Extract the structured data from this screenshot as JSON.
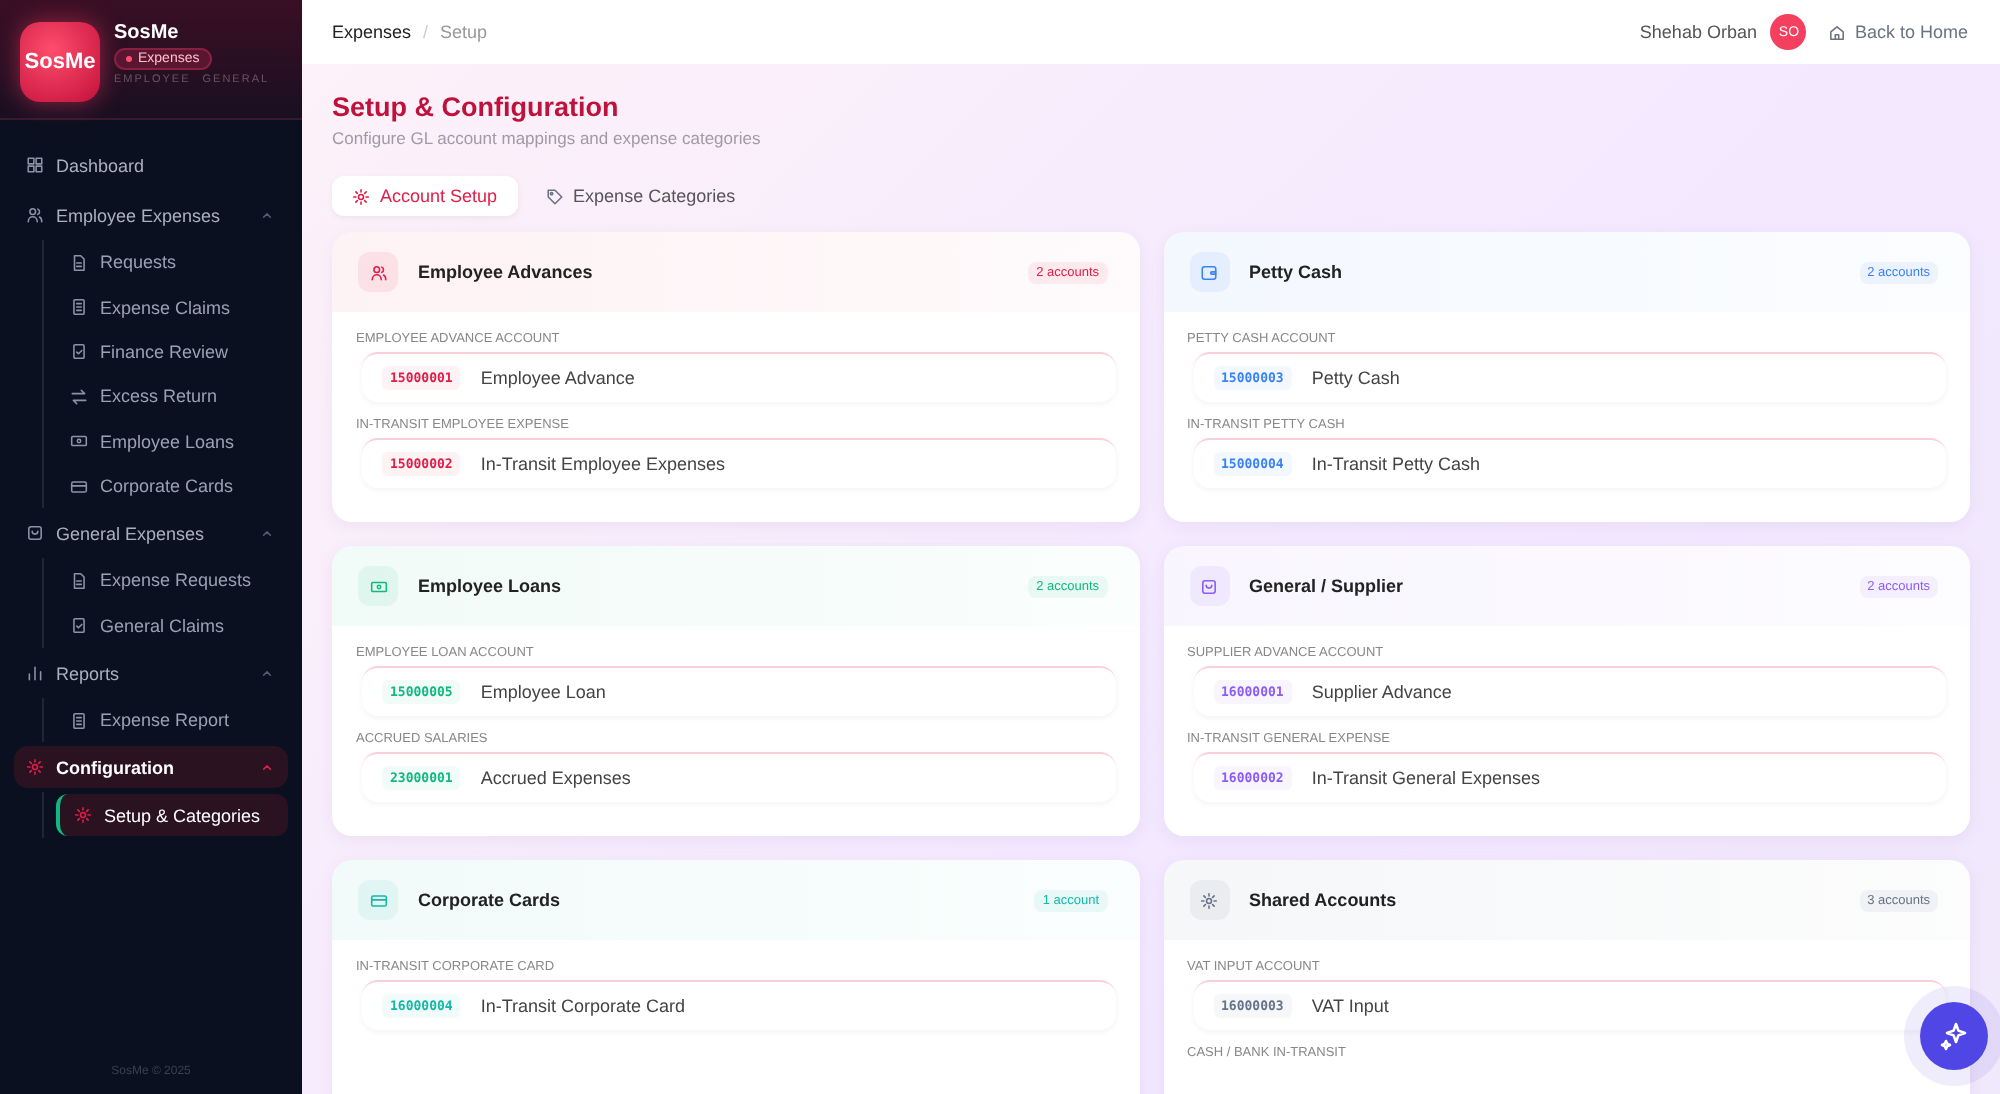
{
  "sidebar": {
    "logo": "SosMe",
    "brand": "SosMe",
    "badge": "Expenses",
    "tags": [
      "EMPLOYEE",
      "GENERAL"
    ],
    "items": [
      {
        "kind": "link",
        "label": "Dashboard",
        "selected": false
      },
      {
        "kind": "group",
        "label": "Employee Expenses",
        "expanded": true,
        "selected": false,
        "children": [
          {
            "label": "Requests",
            "selected": false
          },
          {
            "label": "Expense Claims",
            "selected": false
          },
          {
            "label": "Finance Review",
            "selected": false
          },
          {
            "label": "Excess Return",
            "selected": false
          },
          {
            "label": "Employee Loans",
            "selected": false
          },
          {
            "label": "Corporate Cards",
            "selected": false
          }
        ]
      },
      {
        "kind": "group",
        "label": "General Expenses",
        "expanded": true,
        "selected": false,
        "children": [
          {
            "label": "Expense Requests",
            "selected": false
          },
          {
            "label": "General Claims",
            "selected": false
          }
        ]
      },
      {
        "kind": "group",
        "label": "Reports",
        "expanded": true,
        "selected": false,
        "children": [
          {
            "label": "Expense Report",
            "selected": false
          }
        ]
      },
      {
        "kind": "group",
        "label": "Configuration",
        "expanded": true,
        "selected": true,
        "children": [
          {
            "label": "Setup & Categories",
            "selected": true
          }
        ]
      }
    ],
    "footer": "SosMe © 2025"
  },
  "header": {
    "breadcrumb": [
      "Expenses",
      "Setup"
    ],
    "separator": "/",
    "user": "Shehab Orban",
    "avatar": "SO",
    "home_link": "Back to Home"
  },
  "page": {
    "title": "Setup & Configuration",
    "subtitle": "Configure GL account mappings and expense categories"
  },
  "tabs": [
    {
      "label": "Account Setup",
      "selected": true
    },
    {
      "label": "Expense Categories",
      "selected": false
    }
  ],
  "cards": [
    {
      "title": "Employee Advances",
      "count": "2 accounts",
      "color": "#e11d48",
      "fields": [
        {
          "label": "EMPLOYEE ADVANCE ACCOUNT",
          "code": "15000001",
          "name": "Employee Advance"
        },
        {
          "label": "IN-TRANSIT EMPLOYEE EXPENSE",
          "code": "15000002",
          "name": "In-Transit Employee Expenses"
        }
      ]
    },
    {
      "title": "Petty Cash",
      "count": "2 accounts",
      "color": "#3b82f6",
      "fields": [
        {
          "label": "PETTY CASH ACCOUNT",
          "code": "15000003",
          "name": "Petty Cash"
        },
        {
          "label": "IN-TRANSIT PETTY CASH",
          "code": "15000004",
          "name": "In-Transit Petty Cash"
        }
      ]
    },
    {
      "title": "Employee Loans",
      "count": "2 accounts",
      "color": "#10b981",
      "fields": [
        {
          "label": "EMPLOYEE LOAN ACCOUNT",
          "code": "15000005",
          "name": "Employee Loan"
        },
        {
          "label": "ACCRUED SALARIES",
          "code": "23000001",
          "name": "Accrued Expenses"
        }
      ]
    },
    {
      "title": "General / Supplier",
      "count": "2 accounts",
      "color": "#8b5cf6",
      "fields": [
        {
          "label": "SUPPLIER ADVANCE ACCOUNT",
          "code": "16000001",
          "name": "Supplier Advance"
        },
        {
          "label": "IN-TRANSIT GENERAL EXPENSE",
          "code": "16000002",
          "name": "In-Transit General Expenses"
        }
      ]
    },
    {
      "title": "Corporate Cards",
      "count": "1 account",
      "color": "#14b8a6",
      "fields": [
        {
          "label": "IN-TRANSIT CORPORATE CARD",
          "code": "16000004",
          "name": "In-Transit Corporate Card"
        }
      ]
    },
    {
      "title": "Shared Accounts",
      "count": "3 accounts",
      "color": "#64748b",
      "fields": [
        {
          "label": "VAT INPUT ACCOUNT",
          "code": "16000003",
          "name": "VAT Input"
        },
        {
          "label": "CASH / BANK IN-TRANSIT"
        }
      ]
    }
  ]
}
